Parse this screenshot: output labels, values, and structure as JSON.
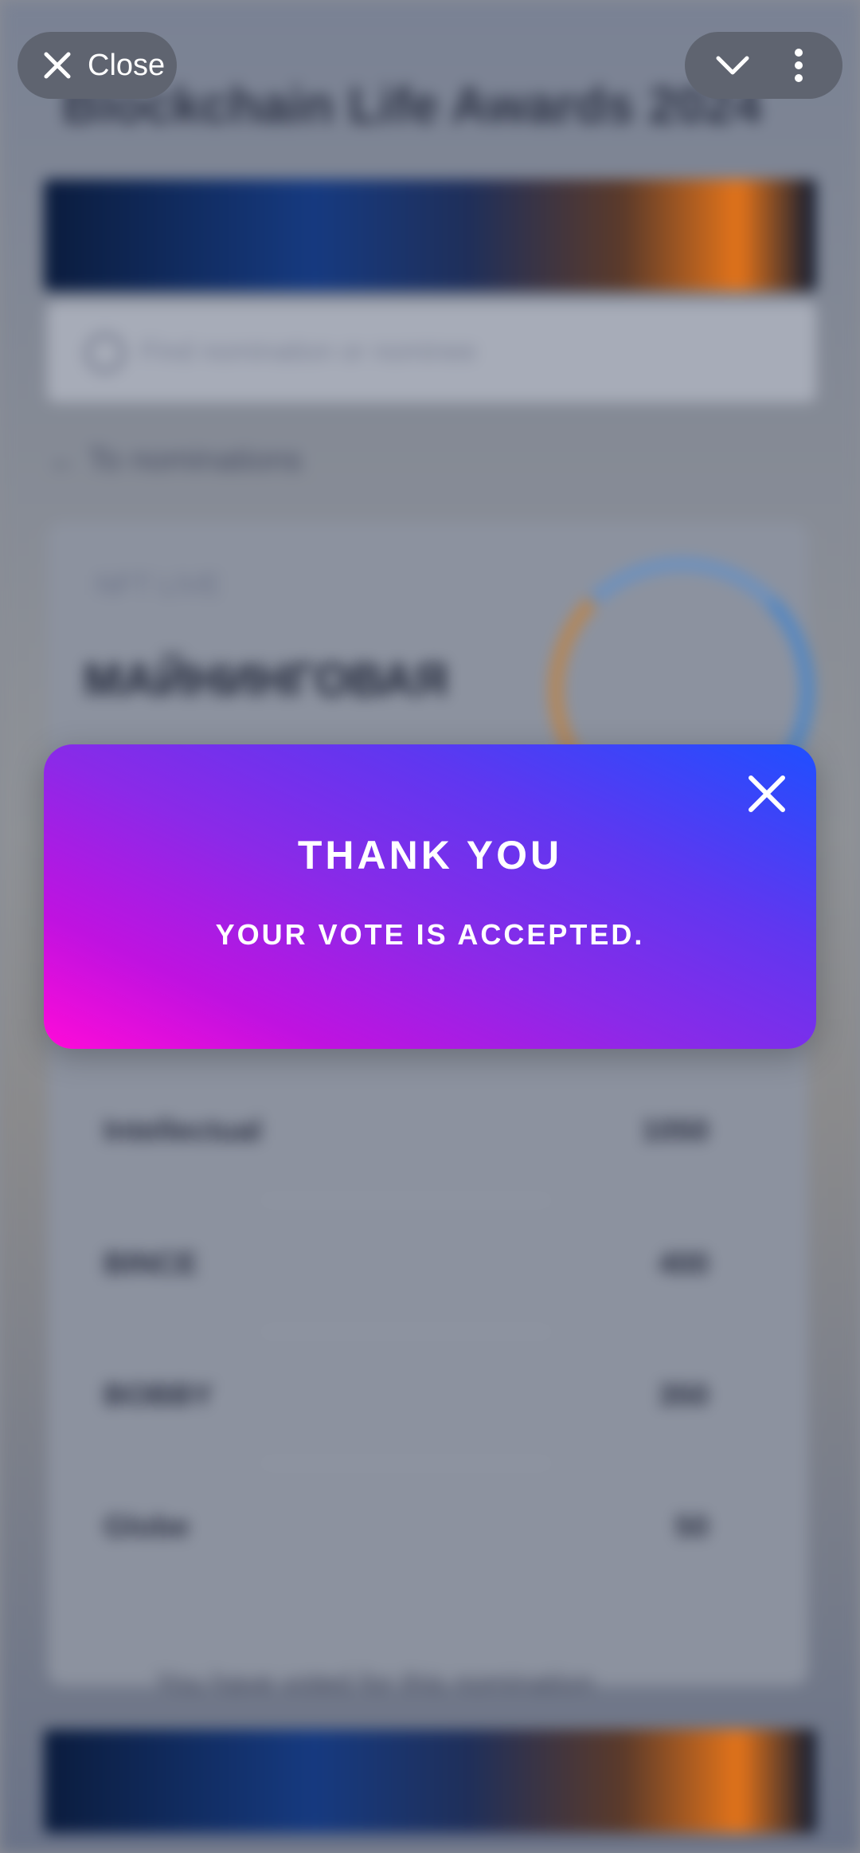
{
  "browser": {
    "close_label": "Close",
    "icons": [
      "close-icon",
      "chevron-down-icon",
      "more-vertical-icon"
    ]
  },
  "background": {
    "title": "Blockchain Life Awards 2024",
    "search_placeholder": "Find nomination or nominee",
    "back_label": "To nominations",
    "card": {
      "tag": "NFT LIVE",
      "heading": "МАЙНИНГОВАЯ"
    },
    "rows": [
      {
        "name": "Intellectual",
        "value": "1050"
      },
      {
        "name": "BINCE",
        "value": "400"
      },
      {
        "name": "BOBBY",
        "value": "350"
      },
      {
        "name": "Globe",
        "value": "50"
      }
    ],
    "footer_text": "You have voted for this nomination"
  },
  "modal": {
    "title": "THANK YOU",
    "message": "YOUR VOTE IS ACCEPTED.",
    "gradient": [
      "#ff0ad8",
      "#8a2ae8",
      "#1f4fff"
    ]
  }
}
